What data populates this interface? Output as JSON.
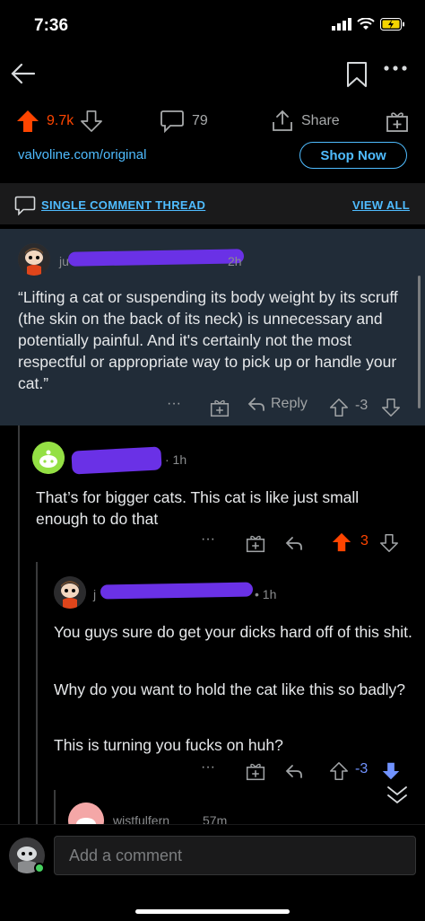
{
  "status_bar": {
    "time": "7:36"
  },
  "post": {
    "upvotes": "9.7k",
    "comments": "79",
    "share_label": "Share",
    "ad_link": "valvoline.com/original",
    "shop_label": "Shop Now"
  },
  "thread_bar": {
    "label": "SINGLE COMMENT THREAD",
    "view_all": "VIEW ALL"
  },
  "comments": [
    {
      "username_partial": "ju",
      "time_partial": "2h",
      "body": "“Lifting a cat or suspending its body weight by its scruff (the skin on the back of its neck) is unnecessary and potentially painful. And it's certainly not the most respectful or appropriate way to pick up or handle your cat.”",
      "reply_label": "Reply",
      "score": "-3",
      "more": "···"
    },
    {
      "time_partial": "· 1h",
      "body": "That’s for bigger cats. This cat is like just small enough to do that",
      "score": "3",
      "more": "···"
    },
    {
      "username_partial": "j",
      "time_partial": "• 1h",
      "body_lines": [
        "You guys sure do get your dicks hard off of this shit.",
        "Why do you want to hold the cat like this so badly?",
        "This is turning you fucks on huh?"
      ],
      "score": "-3",
      "more": "···"
    },
    {
      "username_partial": "wistfulfern",
      "time_partial": "57m"
    }
  ],
  "composer": {
    "placeholder": "Add a comment"
  },
  "colors": {
    "upvote": "#ff4500",
    "downvote": "#7193ff",
    "link": "#4fbcff",
    "highlight_bg": "#212c38",
    "redaction": "#6a31e6"
  }
}
